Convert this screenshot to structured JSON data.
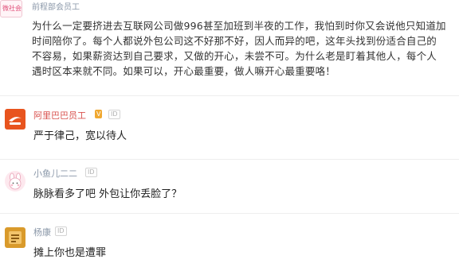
{
  "top_comment": {
    "avatar_text": "微社会",
    "username": "前程部会员工",
    "lines": [
      "为什么一定要挤进去互联网公司做996甚至加班到半夜的工作，我怕到时你又会说他只知道加",
      "时间陪你了。每个人都说外包公司这不好那不好，因人而异的吧，这年头找到份适合自己的",
      "不容易，如果薪资达到自己要求，又做的开心，未尝不可。为什么老是盯着其他人，每个人",
      "遇时区本来就不同。如果可以，开心最重要，做人嘛开心最重要咯！"
    ]
  },
  "comments": [
    {
      "username": "阿里巴巴员工",
      "badge_vip": "V",
      "badge_id": "ID",
      "text": "严于律己，宽以待人",
      "avatar_color": "#e8541e"
    },
    {
      "username": "小鱼儿二二",
      "badge_id": "ID",
      "text": "脉脉看多了吧 外包让你丢脸了？",
      "avatar_color": "#f6e0e6"
    },
    {
      "username": "杨康",
      "badge_id": "ID",
      "text": "摊上你也是遭罪",
      "avatar_color": "#d99a2b"
    }
  ]
}
